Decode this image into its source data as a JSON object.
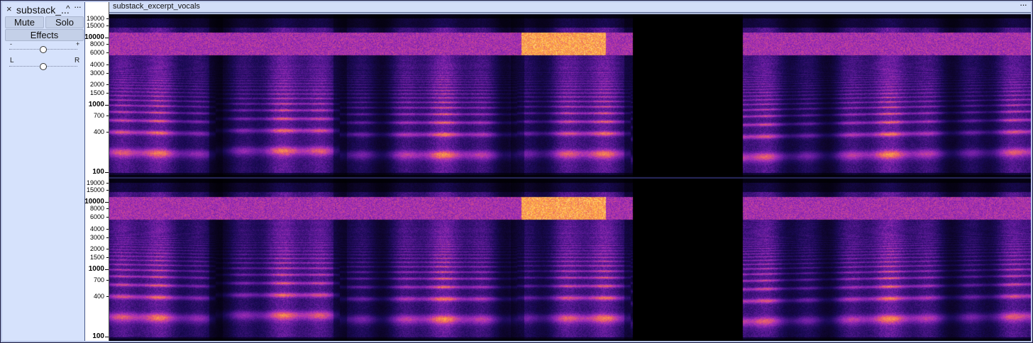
{
  "track": {
    "name": "substack_...",
    "close_glyph": "×",
    "collapse_glyph": "^",
    "menu_glyph": "···",
    "mute_label": "Mute",
    "solo_label": "Solo",
    "effects_label": "Effects",
    "gain": {
      "min_label": "-",
      "max_label": "+",
      "value": 0.5
    },
    "pan": {
      "left_label": "L",
      "right_label": "R",
      "value": 0.5
    }
  },
  "clip": {
    "title": "substack_excerpt_vocals",
    "menu_glyph": "···"
  },
  "ruler": {
    "scale": "log",
    "freq_min": 85,
    "freq_max": 22050,
    "ticks": [
      {
        "label": "19000",
        "value": 19000,
        "major": false
      },
      {
        "label": "15000",
        "value": 15000,
        "major": false
      },
      {
        "label": "10000",
        "value": 10000,
        "major": true
      },
      {
        "label": "8000",
        "value": 8000,
        "major": false
      },
      {
        "label": "6000",
        "value": 6000,
        "major": false
      },
      {
        "label": "4000",
        "value": 4000,
        "major": false
      },
      {
        "label": "3000",
        "value": 3000,
        "major": false
      },
      {
        "label": "2000",
        "value": 2000,
        "major": false
      },
      {
        "label": "1500",
        "value": 1500,
        "major": false
      },
      {
        "label": "1000",
        "value": 1000,
        "major": true
      },
      {
        "label": "700",
        "value": 700,
        "major": false
      },
      {
        "label": "400",
        "value": 400,
        "major": false
      },
      {
        "label": "100",
        "value": 100,
        "major": true
      }
    ]
  },
  "colors": {
    "panel_bg": "#d6e2fc",
    "frame_border": "#1a1a40",
    "spectrogram_palette": [
      "#000000",
      "#1a0a55",
      "#5d1a9b",
      "#a62fb8",
      "#e85c6e",
      "#ffb23c",
      "#ffffe0"
    ]
  }
}
